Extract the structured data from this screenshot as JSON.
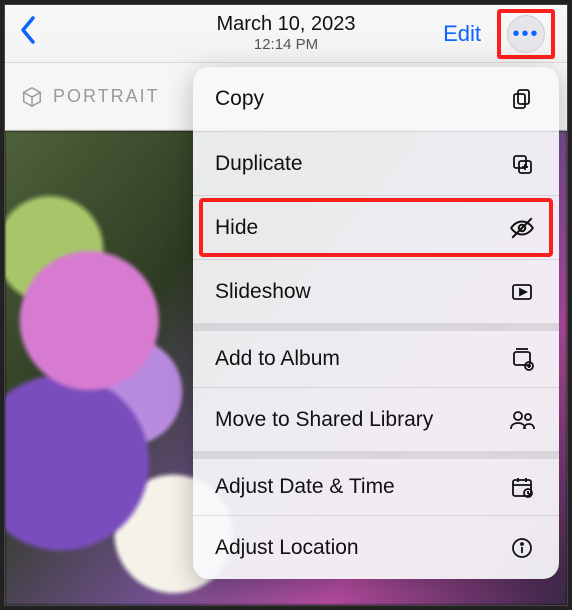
{
  "navbar": {
    "date": "March 10, 2023",
    "time": "12:14 PM",
    "edit_label": "Edit",
    "more_glyph": "•••"
  },
  "badge": {
    "label": "PORTRAIT"
  },
  "menu": {
    "items": [
      {
        "label": "Copy",
        "icon": "copy-icon"
      },
      {
        "label": "Duplicate",
        "icon": "duplicate-icon"
      },
      {
        "label": "Hide",
        "icon": "hide-icon"
      },
      {
        "label": "Slideshow",
        "icon": "slideshow-icon"
      },
      {
        "label": "Add to Album",
        "icon": "add-album-icon"
      },
      {
        "label": "Move to Shared Library",
        "icon": "shared-library-icon"
      },
      {
        "label": "Adjust Date & Time",
        "icon": "calendar-icon"
      },
      {
        "label": "Adjust Location",
        "icon": "info-icon"
      }
    ]
  }
}
